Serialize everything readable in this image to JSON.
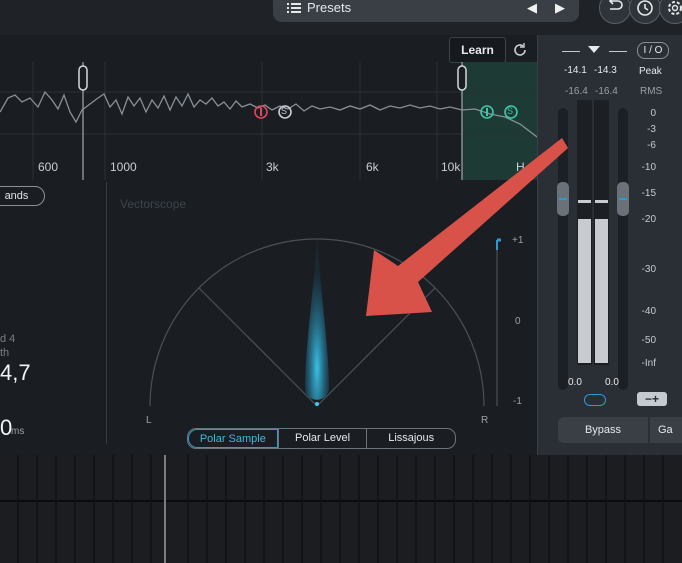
{
  "header": {
    "presets_label": "Presets",
    "prev_glyph": "◀",
    "next_glyph": "▶"
  },
  "eq": {
    "learn_label": "Learn",
    "freq_labels": [
      "600",
      "1000",
      "3k",
      "6k",
      "10k",
      "H"
    ],
    "band_markers": [
      "S",
      "S"
    ]
  },
  "left": {
    "bands_label": "ands",
    "text1": "d 4",
    "text2": "th",
    "value": "4,7",
    "ms_value": "0",
    "ms_unit": "ms"
  },
  "vectorscope": {
    "title": "Vectorscope",
    "left_label": "L",
    "right_label": "R",
    "scale_top": "+1",
    "scale_mid": "0",
    "scale_bottom": "-1",
    "tabs": [
      "Polar Sample",
      "Polar Level",
      "Lissajous"
    ],
    "active_tab": "Polar Sample"
  },
  "meters": {
    "io_label": "I / O",
    "peak_left": "-14.1",
    "peak_right": "-14.3",
    "peak_label": "Peak",
    "rms_left": "-16.4",
    "rms_right": "-16.4",
    "rms_label": "RMS",
    "scale": [
      "0",
      "-3",
      "-6",
      "-10",
      "-15",
      "-20",
      "-30",
      "-40",
      "-50",
      "-Inf"
    ],
    "out_left": "0.0",
    "out_right": "0.0",
    "bypass_label": "Bypass",
    "gain_label": "Ga",
    "accent_color": "#2c9bd0"
  }
}
